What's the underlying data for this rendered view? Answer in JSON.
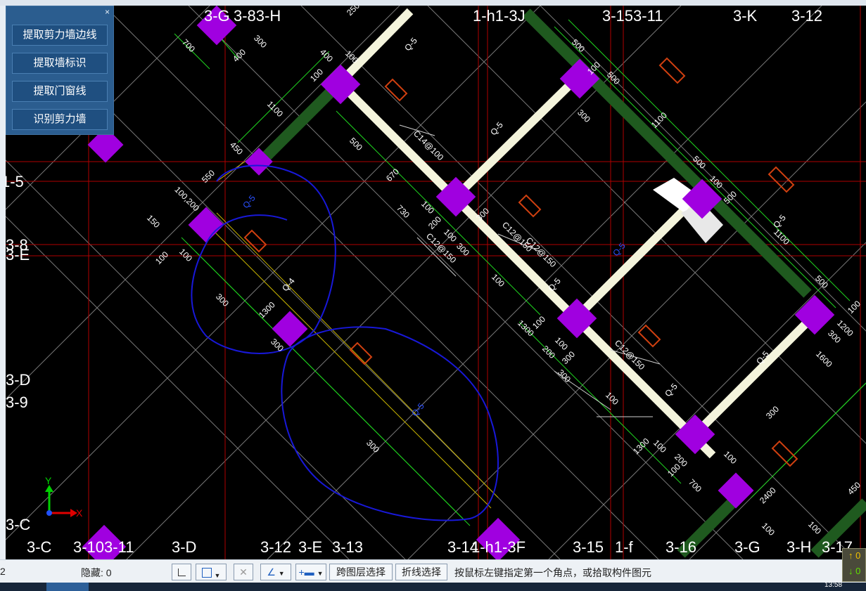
{
  "panel": {
    "close_label": "×",
    "buttons": [
      "提取剪力墙边线",
      "提取墙标识",
      "提取门窗线",
      "识别剪力墙"
    ]
  },
  "grid_labels": {
    "top": [
      "3-G",
      "3-83-H",
      "1-h1-3J",
      "3-153-11",
      "3-K",
      "3-12"
    ],
    "left": [
      "1-5",
      "3-8",
      "3-E",
      "3-D",
      "3-9",
      "3-C"
    ],
    "bottom": [
      "3-C",
      "3-103-11",
      "3-D",
      "3-12",
      "3-E",
      "3-13",
      "3-14",
      "1-h1-3F",
      "3-15",
      "1-f",
      "3-16",
      "3-G",
      "3-H",
      "3-17"
    ]
  },
  "dimension_labels": [
    "250",
    "700",
    "300",
    "400",
    "400",
    "100",
    "100",
    "1100",
    "450",
    "550",
    "100,200",
    "150",
    "100",
    "100",
    "300",
    "1300",
    "300",
    "500",
    "670",
    "730",
    "100",
    "200",
    "100",
    "300",
    "300",
    "100",
    "1300",
    "100",
    "200",
    "100",
    "300",
    "300",
    "100",
    "1300",
    "100",
    "200",
    "100",
    "700",
    "500",
    "100",
    "500",
    "300",
    "1100",
    "500",
    "100",
    "500",
    "1100",
    "500",
    "100",
    "300",
    "1600",
    "300",
    "100",
    "1200",
    "450",
    "100",
    "100",
    "2400",
    "300"
  ],
  "wall_tags": [
    "Q-5",
    "Q-5",
    "Q-5",
    "Q-4",
    "Q-5",
    "Q-5",
    "Q-5",
    "Q-5",
    "Q-5",
    "Q-5"
  ],
  "rebar_labels": [
    "C14@100",
    "C12@150",
    "C12@150",
    "C12@150",
    "C12@150"
  ],
  "axis": {
    "y": "Y",
    "x": "X"
  },
  "status": {
    "left_value": "2",
    "hidden_label": "隐藏: 0",
    "cross_layer_label": "跨图层选择",
    "polyline_label": "折线选择",
    "prompt": "按鼠标左键指定第一个角点，或拾取构件图元",
    "indicator_up": "↑ 0",
    "indicator_down": "↓ 0"
  },
  "taskbar": {
    "clock": "13:58"
  },
  "colors": {
    "background": "#000000",
    "grid_red": "#b00000",
    "grid_white": "#9a9a9a",
    "dim_green": "#1fd41f",
    "wall_green": "#1f5a1f",
    "column_purple": "#a000e0",
    "wall_white": "#f4f4dc",
    "annotation_blue": "#1818d8",
    "rebar_orange": "#d04010",
    "label_white": "#ffffff",
    "panel_blue": "#2b5d8f"
  }
}
